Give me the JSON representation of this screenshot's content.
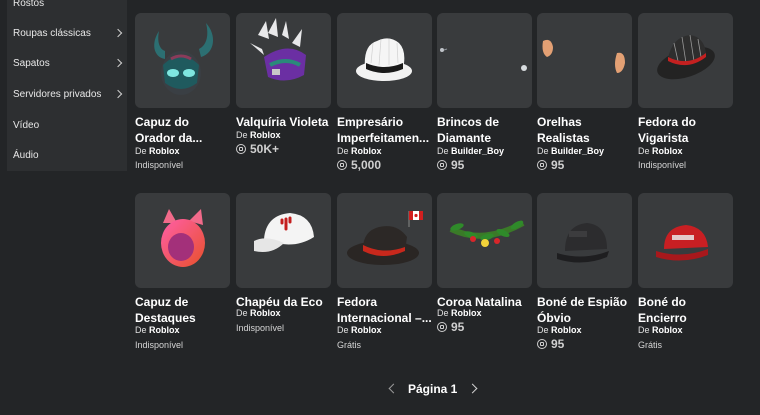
{
  "sidebar": {
    "items": [
      {
        "label": "Rostos",
        "chevron": false
      },
      {
        "label": "Roupas clássicas",
        "chevron": true
      },
      {
        "label": "Sapatos",
        "chevron": true
      },
      {
        "label": "Servidores privados",
        "chevron": true
      },
      {
        "label": "Vídeo",
        "chevron": false
      },
      {
        "label": "Áudio",
        "chevron": false
      }
    ]
  },
  "items": [
    {
      "name": "Capuz do\nOrador da...",
      "creator_prefix": "De",
      "creator": "Roblox",
      "price": "Indisponível",
      "price_type": "text",
      "icon": "horned-hood-icon"
    },
    {
      "name": "Valquíria Violeta",
      "creator_prefix": "De",
      "creator": "Roblox",
      "price": "50K+",
      "price_type": "robux",
      "icon": "valkyrie-helm-icon"
    },
    {
      "name": "Empresário\nImperfeitamen...",
      "creator_prefix": "De",
      "creator": "Roblox",
      "price": "5,000",
      "price_type": "robux",
      "icon": "white-fedora-icon"
    },
    {
      "name": "Brincos de\nDiamante",
      "creator_prefix": "De",
      "creator": "Builder_Boy",
      "price": "95",
      "price_type": "robux",
      "icon": "diamond-earrings-icon"
    },
    {
      "name": "Orelhas\nRealistas",
      "creator_prefix": "De",
      "creator": "Builder_Boy",
      "price": "95",
      "price_type": "robux",
      "icon": "realistic-ears-icon"
    },
    {
      "name": "Fedora do\nVigarista",
      "creator_prefix": "De",
      "creator": "Roblox",
      "price": "Indisponível",
      "price_type": "text",
      "icon": "striped-fedora-icon"
    },
    {
      "name": "Capuz de\nDestaques",
      "creator_prefix": "De",
      "creator": "Roblox",
      "price": "Indisponível",
      "price_type": "text",
      "icon": "cat-ear-hood-icon"
    },
    {
      "name": "Chapéu da Eco",
      "creator_prefix": "De",
      "creator": "Roblox",
      "price": "Indisponível",
      "price_type": "text",
      "icon": "cactus-cap-icon"
    },
    {
      "name": "Fedora\nInternacional –...",
      "creator_prefix": "De",
      "creator": "Roblox",
      "price": "Grátis",
      "price_type": "text",
      "icon": "canada-fedora-icon"
    },
    {
      "name": "Coroa Natalina",
      "creator_prefix": "De",
      "creator": "Roblox",
      "price": "95",
      "price_type": "robux",
      "icon": "holly-crown-icon"
    },
    {
      "name": "Boné de Espião\nÓbvio",
      "creator_prefix": "De",
      "creator": "Roblox",
      "price": "95",
      "price_type": "robux",
      "icon": "spy-cap-icon"
    },
    {
      "name": "Boné do\nEncierro",
      "creator_prefix": "De",
      "creator": "Roblox",
      "price": "Grátis",
      "price_type": "text",
      "icon": "red-cap-icon"
    }
  ],
  "pagination": {
    "label": "Página 1"
  }
}
